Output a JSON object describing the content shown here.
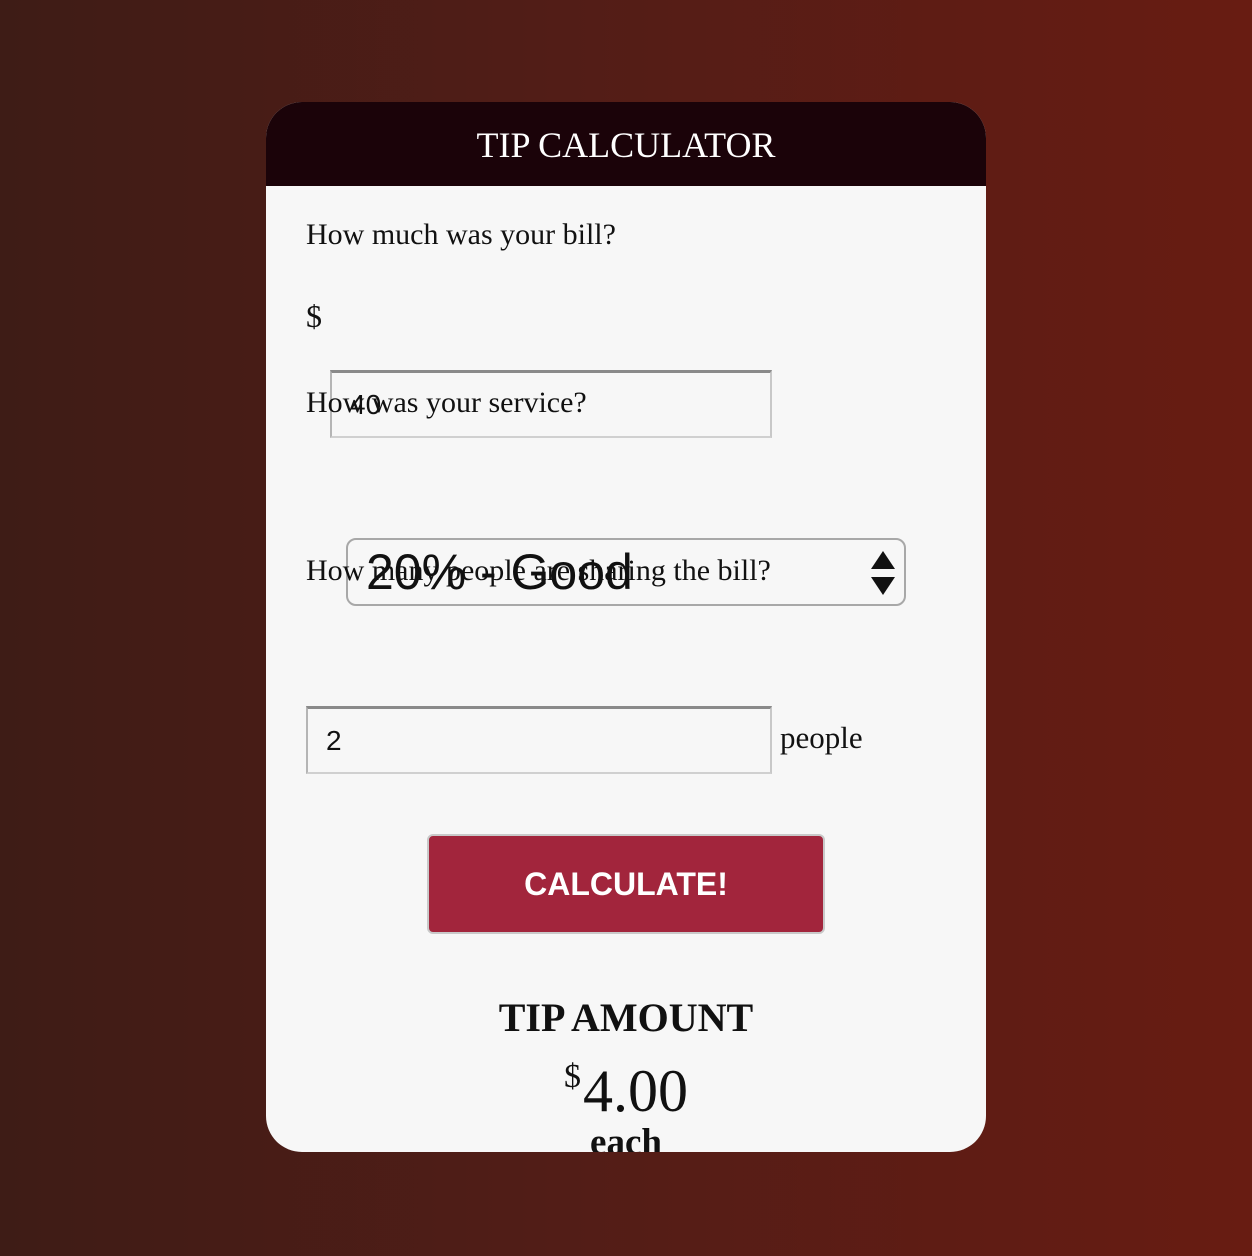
{
  "header": {
    "title": "TIP CALCULATOR"
  },
  "bill": {
    "question": "How much was your bill?",
    "currency_symbol": "$",
    "value": "40"
  },
  "service": {
    "question": "How was your service?",
    "selected": "20% - Good",
    "arrows_icon": "select-up-down-arrows-icon"
  },
  "people": {
    "question": "How many people are sharing the bill?",
    "value": "2",
    "suffix": "people"
  },
  "action": {
    "calculate_label": "CALCULATE!"
  },
  "result": {
    "label": "TIP AMOUNT",
    "currency_symbol": "$",
    "amount": "4.00",
    "per": "each"
  },
  "colors": {
    "header_bg": "#1b0309",
    "button_bg": "#a2253c",
    "card_bg": "#f7f7f7",
    "background_left": "#3e1c16",
    "background_right": "#681c12"
  }
}
